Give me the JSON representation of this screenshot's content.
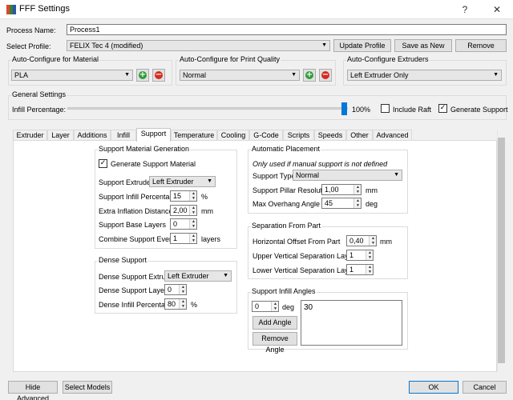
{
  "window": {
    "title": "FFF Settings",
    "help_glyph": "?",
    "close_glyph": "✕"
  },
  "process": {
    "label": "Process Name:",
    "value": "Process1"
  },
  "profile": {
    "label": "Select Profile:",
    "value": "FELIX Tec 4 (modified)",
    "update_label": "Update Profile",
    "save_as_label": "Save as New",
    "remove_label": "Remove"
  },
  "autoconfig": {
    "material": {
      "title": "Auto-Configure for Material",
      "value": "PLA"
    },
    "quality": {
      "title": "Auto-Configure for Print Quality",
      "value": "Normal"
    },
    "extruders": {
      "title": "Auto-Configure Extruders",
      "value": "Left Extruder Only"
    },
    "add_glyph": "+",
    "remove_glyph": "−"
  },
  "general": {
    "title": "General Settings",
    "infill_label": "Infill Percentage:",
    "infill_value": "100%",
    "infill_fraction": 1.0,
    "raft_label": "Include Raft",
    "raft_checked": false,
    "support_label": "Generate Support",
    "support_checked": true
  },
  "tabs": [
    {
      "label": "Extruder"
    },
    {
      "label": "Layer"
    },
    {
      "label": "Additions"
    },
    {
      "label": "Infill"
    },
    {
      "label": "Support"
    },
    {
      "label": "Temperature"
    },
    {
      "label": "Cooling"
    },
    {
      "label": "G-Code"
    },
    {
      "label": "Scripts"
    },
    {
      "label": "Speeds"
    },
    {
      "label": "Other"
    },
    {
      "label": "Advanced"
    }
  ],
  "active_tab": "Support",
  "support_gen": {
    "title": "Support Material Generation",
    "generate_label": "Generate Support Material",
    "generate_checked": true,
    "extruder_label": "Support Extruder",
    "extruder_value": "Left Extruder",
    "infill_pct_label": "Support Infill Percentage",
    "infill_pct_value": "15",
    "infill_pct_unit": "%",
    "inflation_label": "Extra Inflation Distance",
    "inflation_value": "2,00",
    "inflation_unit": "mm",
    "base_layers_label": "Support Base Layers",
    "base_layers_value": "0",
    "combine_label": "Combine Support Every",
    "combine_value": "1",
    "combine_unit": "layers"
  },
  "dense": {
    "title": "Dense Support",
    "extruder_label": "Dense Support Extruder",
    "extruder_value": "Left Extruder",
    "layers_label": "Dense Support Layers",
    "layers_value": "0",
    "infill_label": "Dense Infill Percentage",
    "infill_value": "80",
    "infill_unit": "%"
  },
  "auto_place": {
    "title": "Automatic Placement",
    "note": "Only used if manual support is not defined",
    "type_label": "Support Type",
    "type_value": "Normal",
    "pillar_label": "Support Pillar Resolution",
    "pillar_value": "1,00",
    "pillar_unit": "mm",
    "overhang_label": "Max Overhang Angle",
    "overhang_value": "45",
    "overhang_unit": "deg"
  },
  "separation": {
    "title": "Separation From Part",
    "horiz_label": "Horizontal Offset From Part",
    "horiz_value": "0,40",
    "horiz_unit": "mm",
    "upper_label": "Upper Vertical Separation Layers",
    "upper_value": "1",
    "lower_label": "Lower Vertical Separation Layers",
    "lower_value": "1"
  },
  "angles": {
    "title": "Support Infill Angles",
    "input_value": "0",
    "unit": "deg",
    "add_label": "Add Angle",
    "remove_label": "Remove Angle",
    "list": "30"
  },
  "footer": {
    "hide_advanced": "Hide Advanced",
    "select_models": "Select Models",
    "ok": "OK",
    "cancel": "Cancel"
  },
  "colors": {
    "accent": "#0078d7",
    "add_green": "#2e9d3a",
    "remove_red": "#d62b20"
  }
}
